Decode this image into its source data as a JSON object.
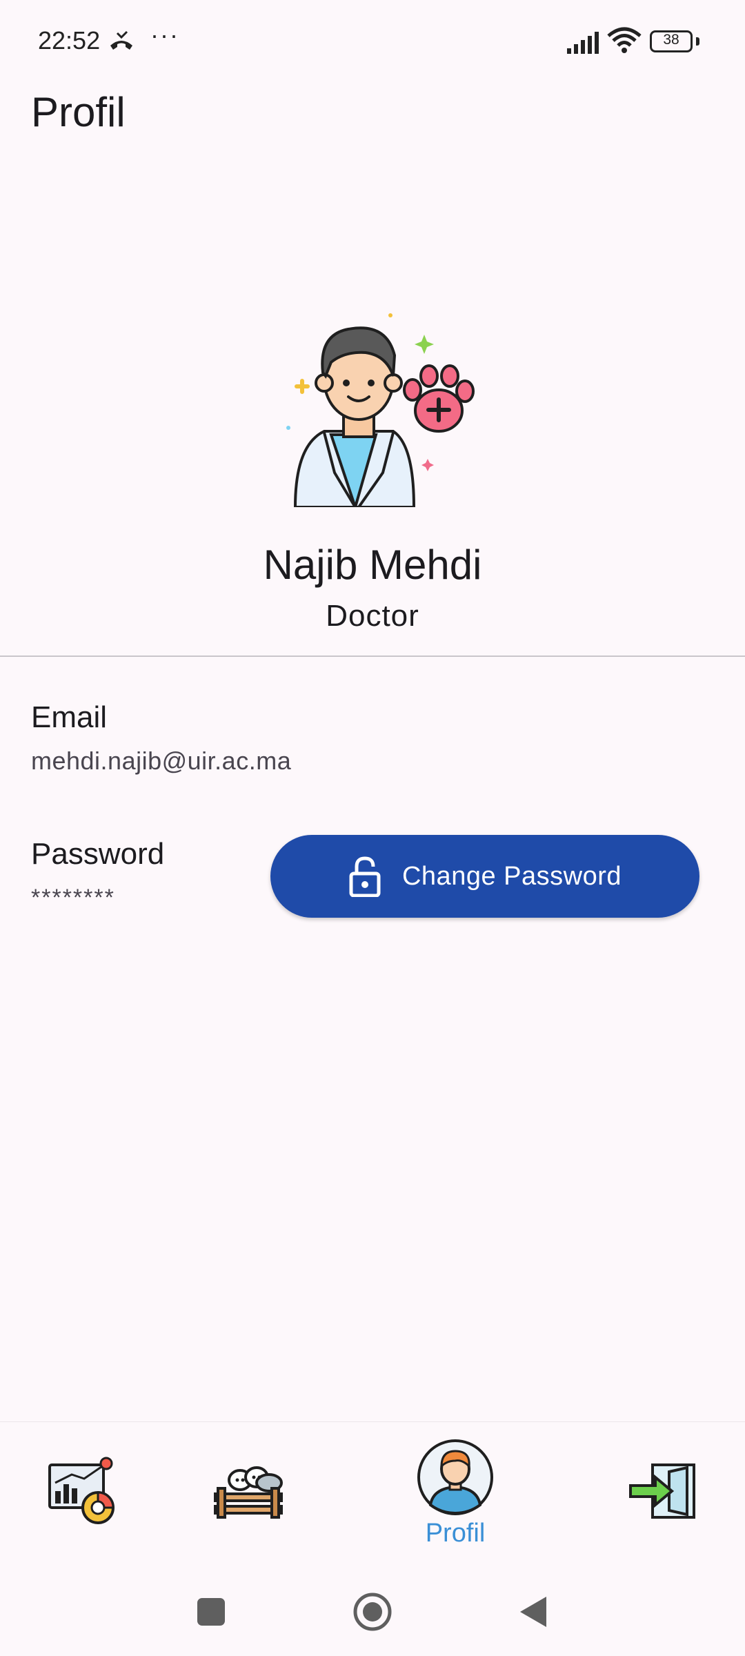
{
  "status_bar": {
    "time": "22:52",
    "more": "···",
    "battery": "38",
    "icons": [
      "missed-call-icon",
      "signal-icon",
      "wifi-icon",
      "battery-icon"
    ]
  },
  "header": {
    "title": "Profil"
  },
  "profile": {
    "name": "Najib Mehdi",
    "role": "Doctor",
    "avatar": "veterinarian-avatar-icon"
  },
  "fields": {
    "email_label": "Email",
    "email_value": "mehdi.najib@uir.ac.ma",
    "password_label": "Password",
    "password_value": "********"
  },
  "actions": {
    "change_password": "Change Password",
    "change_password_icon": "lock-open-icon"
  },
  "bottom_nav": {
    "items": [
      {
        "icon": "dashboard-chart-icon",
        "label": ""
      },
      {
        "icon": "livestock-cows-icon",
        "label": ""
      },
      {
        "icon": "profile-avatar-icon",
        "label": "Profil",
        "active": true
      },
      {
        "icon": "logout-arrow-icon",
        "label": ""
      }
    ],
    "active_color": "#3a8fd6"
  },
  "colors": {
    "accent": "#1f4ba9",
    "background": "#fdf8fb"
  }
}
